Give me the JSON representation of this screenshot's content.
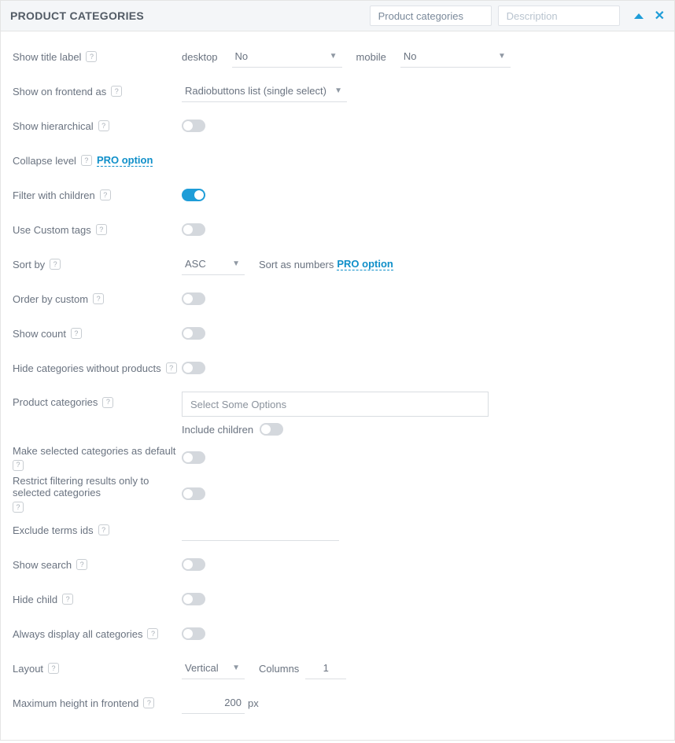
{
  "header": {
    "title": "PRODUCT CATEGORIES",
    "title_input_value": "Product categories",
    "description_placeholder": "Description"
  },
  "pro_option_label": "PRO option",
  "rows": {
    "show_title_label": "Show title label",
    "desktop_label": "desktop",
    "mobile_label": "mobile",
    "show_title_desktop": "No",
    "show_title_mobile": "No",
    "show_on_frontend_as": "Show on frontend as",
    "show_on_frontend_as_value": "Radiobuttons list (single select)",
    "show_hierarchical": "Show hierarchical",
    "collapse_level": "Collapse level",
    "filter_with_children": "Filter with children",
    "use_custom_tags": "Use Custom tags",
    "sort_by": "Sort by",
    "sort_by_value": "ASC",
    "sort_as_numbers": "Sort as numbers",
    "order_by_custom": "Order by custom",
    "show_count": "Show count",
    "hide_empty": "Hide categories without products",
    "product_categories": "Product categories",
    "product_categories_placeholder": "Select Some Options",
    "include_children": "Include children",
    "make_default": "Make selected categories as default",
    "restrict_results": "Restrict filtering results only to selected categories",
    "exclude_terms": "Exclude terms ids",
    "show_search": "Show search",
    "hide_child": "Hide child",
    "always_display_all": "Always display all categories",
    "layout": "Layout",
    "layout_value": "Vertical",
    "columns_label": "Columns",
    "columns_value": "1",
    "maximum_height": "Maximum height in frontend",
    "maximum_height_value": "200",
    "px_unit": "px"
  }
}
